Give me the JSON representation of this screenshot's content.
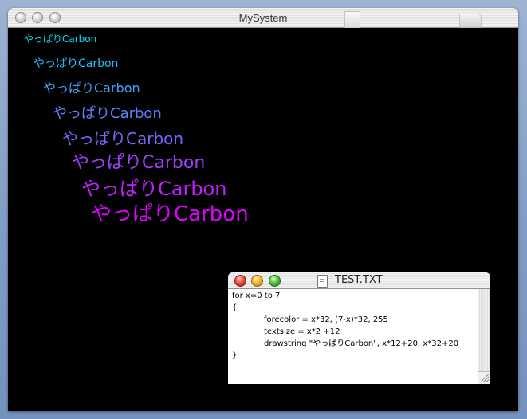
{
  "main_window": {
    "title": "MySystem",
    "carbon_text": [
      {
        "text": "やっぱりCarbon",
        "color": "#00e0ff"
      },
      {
        "text": "やっぱりCarbon",
        "color": "#20c0ff"
      },
      {
        "text": "やっぱりCarbon",
        "color": "#40a0ff"
      },
      {
        "text": "やっぱりCarbon",
        "color": "#6080ff"
      },
      {
        "text": "やっぱりCarbon",
        "color": "#8060ff"
      },
      {
        "text": "やっぱりCarbon",
        "color": "#a040ff"
      },
      {
        "text": "やっぱりCarbon",
        "color": "#c020ff"
      },
      {
        "text": "やっぱりCarbon",
        "color": "#e000ff"
      }
    ]
  },
  "editor_window": {
    "title": "TEST.TXT",
    "lines": [
      "for x=0 to 7",
      "{",
      "forecolor = x*32, (7-x)*32, 255",
      "textsize = x*2 +12",
      "drawstring \"やっぱりCarbon\", x*12+20, x*32+20",
      "}"
    ]
  }
}
